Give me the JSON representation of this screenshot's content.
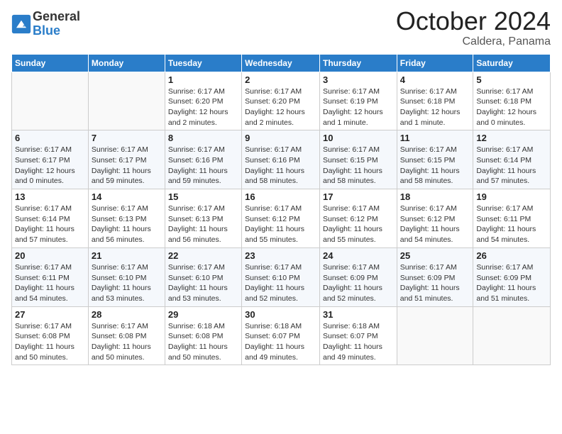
{
  "logo": {
    "general": "General",
    "blue": "Blue"
  },
  "header": {
    "month": "October 2024",
    "location": "Caldera, Panama"
  },
  "weekdays": [
    "Sunday",
    "Monday",
    "Tuesday",
    "Wednesday",
    "Thursday",
    "Friday",
    "Saturday"
  ],
  "weeks": [
    [
      {
        "day": "",
        "sunrise": "",
        "sunset": "",
        "daylight": ""
      },
      {
        "day": "",
        "sunrise": "",
        "sunset": "",
        "daylight": ""
      },
      {
        "day": "1",
        "sunrise": "Sunrise: 6:17 AM",
        "sunset": "Sunset: 6:20 PM",
        "daylight": "Daylight: 12 hours and 2 minutes."
      },
      {
        "day": "2",
        "sunrise": "Sunrise: 6:17 AM",
        "sunset": "Sunset: 6:20 PM",
        "daylight": "Daylight: 12 hours and 2 minutes."
      },
      {
        "day": "3",
        "sunrise": "Sunrise: 6:17 AM",
        "sunset": "Sunset: 6:19 PM",
        "daylight": "Daylight: 12 hours and 1 minute."
      },
      {
        "day": "4",
        "sunrise": "Sunrise: 6:17 AM",
        "sunset": "Sunset: 6:18 PM",
        "daylight": "Daylight: 12 hours and 1 minute."
      },
      {
        "day": "5",
        "sunrise": "Sunrise: 6:17 AM",
        "sunset": "Sunset: 6:18 PM",
        "daylight": "Daylight: 12 hours and 0 minutes."
      }
    ],
    [
      {
        "day": "6",
        "sunrise": "Sunrise: 6:17 AM",
        "sunset": "Sunset: 6:17 PM",
        "daylight": "Daylight: 12 hours and 0 minutes."
      },
      {
        "day": "7",
        "sunrise": "Sunrise: 6:17 AM",
        "sunset": "Sunset: 6:17 PM",
        "daylight": "Daylight: 11 hours and 59 minutes."
      },
      {
        "day": "8",
        "sunrise": "Sunrise: 6:17 AM",
        "sunset": "Sunset: 6:16 PM",
        "daylight": "Daylight: 11 hours and 59 minutes."
      },
      {
        "day": "9",
        "sunrise": "Sunrise: 6:17 AM",
        "sunset": "Sunset: 6:16 PM",
        "daylight": "Daylight: 11 hours and 58 minutes."
      },
      {
        "day": "10",
        "sunrise": "Sunrise: 6:17 AM",
        "sunset": "Sunset: 6:15 PM",
        "daylight": "Daylight: 11 hours and 58 minutes."
      },
      {
        "day": "11",
        "sunrise": "Sunrise: 6:17 AM",
        "sunset": "Sunset: 6:15 PM",
        "daylight": "Daylight: 11 hours and 58 minutes."
      },
      {
        "day": "12",
        "sunrise": "Sunrise: 6:17 AM",
        "sunset": "Sunset: 6:14 PM",
        "daylight": "Daylight: 11 hours and 57 minutes."
      }
    ],
    [
      {
        "day": "13",
        "sunrise": "Sunrise: 6:17 AM",
        "sunset": "Sunset: 6:14 PM",
        "daylight": "Daylight: 11 hours and 57 minutes."
      },
      {
        "day": "14",
        "sunrise": "Sunrise: 6:17 AM",
        "sunset": "Sunset: 6:13 PM",
        "daylight": "Daylight: 11 hours and 56 minutes."
      },
      {
        "day": "15",
        "sunrise": "Sunrise: 6:17 AM",
        "sunset": "Sunset: 6:13 PM",
        "daylight": "Daylight: 11 hours and 56 minutes."
      },
      {
        "day": "16",
        "sunrise": "Sunrise: 6:17 AM",
        "sunset": "Sunset: 6:12 PM",
        "daylight": "Daylight: 11 hours and 55 minutes."
      },
      {
        "day": "17",
        "sunrise": "Sunrise: 6:17 AM",
        "sunset": "Sunset: 6:12 PM",
        "daylight": "Daylight: 11 hours and 55 minutes."
      },
      {
        "day": "18",
        "sunrise": "Sunrise: 6:17 AM",
        "sunset": "Sunset: 6:12 PM",
        "daylight": "Daylight: 11 hours and 54 minutes."
      },
      {
        "day": "19",
        "sunrise": "Sunrise: 6:17 AM",
        "sunset": "Sunset: 6:11 PM",
        "daylight": "Daylight: 11 hours and 54 minutes."
      }
    ],
    [
      {
        "day": "20",
        "sunrise": "Sunrise: 6:17 AM",
        "sunset": "Sunset: 6:11 PM",
        "daylight": "Daylight: 11 hours and 54 minutes."
      },
      {
        "day": "21",
        "sunrise": "Sunrise: 6:17 AM",
        "sunset": "Sunset: 6:10 PM",
        "daylight": "Daylight: 11 hours and 53 minutes."
      },
      {
        "day": "22",
        "sunrise": "Sunrise: 6:17 AM",
        "sunset": "Sunset: 6:10 PM",
        "daylight": "Daylight: 11 hours and 53 minutes."
      },
      {
        "day": "23",
        "sunrise": "Sunrise: 6:17 AM",
        "sunset": "Sunset: 6:10 PM",
        "daylight": "Daylight: 11 hours and 52 minutes."
      },
      {
        "day": "24",
        "sunrise": "Sunrise: 6:17 AM",
        "sunset": "Sunset: 6:09 PM",
        "daylight": "Daylight: 11 hours and 52 minutes."
      },
      {
        "day": "25",
        "sunrise": "Sunrise: 6:17 AM",
        "sunset": "Sunset: 6:09 PM",
        "daylight": "Daylight: 11 hours and 51 minutes."
      },
      {
        "day": "26",
        "sunrise": "Sunrise: 6:17 AM",
        "sunset": "Sunset: 6:09 PM",
        "daylight": "Daylight: 11 hours and 51 minutes."
      }
    ],
    [
      {
        "day": "27",
        "sunrise": "Sunrise: 6:17 AM",
        "sunset": "Sunset: 6:08 PM",
        "daylight": "Daylight: 11 hours and 50 minutes."
      },
      {
        "day": "28",
        "sunrise": "Sunrise: 6:17 AM",
        "sunset": "Sunset: 6:08 PM",
        "daylight": "Daylight: 11 hours and 50 minutes."
      },
      {
        "day": "29",
        "sunrise": "Sunrise: 6:18 AM",
        "sunset": "Sunset: 6:08 PM",
        "daylight": "Daylight: 11 hours and 50 minutes."
      },
      {
        "day": "30",
        "sunrise": "Sunrise: 6:18 AM",
        "sunset": "Sunset: 6:07 PM",
        "daylight": "Daylight: 11 hours and 49 minutes."
      },
      {
        "day": "31",
        "sunrise": "Sunrise: 6:18 AM",
        "sunset": "Sunset: 6:07 PM",
        "daylight": "Daylight: 11 hours and 49 minutes."
      },
      {
        "day": "",
        "sunrise": "",
        "sunset": "",
        "daylight": ""
      },
      {
        "day": "",
        "sunrise": "",
        "sunset": "",
        "daylight": ""
      }
    ]
  ]
}
